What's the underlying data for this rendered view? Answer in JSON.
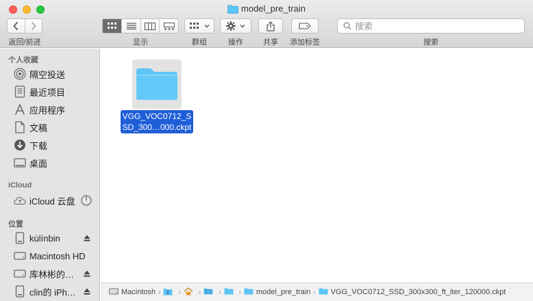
{
  "window": {
    "title": "model_pre_train"
  },
  "toolbar": {
    "back_forward_label": "返回/前进",
    "view_label": "显示",
    "group_label": "群组",
    "action_label": "操作",
    "share_label": "共享",
    "tags_label": "添加标签",
    "search_label": "搜索",
    "search_placeholder": "搜索",
    "view_modes": [
      "icon",
      "list",
      "column",
      "gallery"
    ],
    "active_view": "icon"
  },
  "sidebar": {
    "favorites_header": "个人收藏",
    "favorites": [
      {
        "label": "隔空投送",
        "icon": "airdrop-icon"
      },
      {
        "label": "最近项目",
        "icon": "recents-icon"
      },
      {
        "label": "应用程序",
        "icon": "applications-icon"
      },
      {
        "label": "文稿",
        "icon": "documents-icon"
      },
      {
        "label": "下载",
        "icon": "downloads-icon"
      },
      {
        "label": "桌面",
        "icon": "desktop-icon"
      }
    ],
    "icloud_header": "iCloud",
    "icloud": [
      {
        "label": "iCloud 云盘",
        "icon": "icloud-icon"
      }
    ],
    "locations_header": "位置",
    "locations": [
      {
        "label": "kùlínbin",
        "icon": "drive-icon"
      },
      {
        "label": "Macintosh HD",
        "icon": "drive-icon"
      },
      {
        "label": "库林彬的…",
        "icon": "drive-icon"
      },
      {
        "label": "clin的 iPh…",
        "icon": "drive-icon"
      }
    ]
  },
  "content": {
    "files": [
      {
        "name_line1": "VGG_VOC0712_S",
        "name_line2": "SD_300…000.ckpt",
        "selected": true
      }
    ]
  },
  "pathbar": {
    "crumbs": [
      {
        "label": "Macintosh",
        "icon": "drive-icon"
      },
      {
        "label": "",
        "icon": "user-folder-icon"
      },
      {
        "label": "",
        "icon": "home-icon"
      },
      {
        "label": "",
        "icon": "folder-icon"
      },
      {
        "label": "",
        "icon": "folder-icon"
      },
      {
        "label": "model_pre_train",
        "icon": "folder-icon"
      },
      {
        "label": "VGG_VOC0712_SSD_300x300_ft_iter_120000.ckpt",
        "icon": "folder-icon"
      }
    ]
  },
  "colors": {
    "accent": "#1f5ed8",
    "folder": "#5ec4f5"
  }
}
